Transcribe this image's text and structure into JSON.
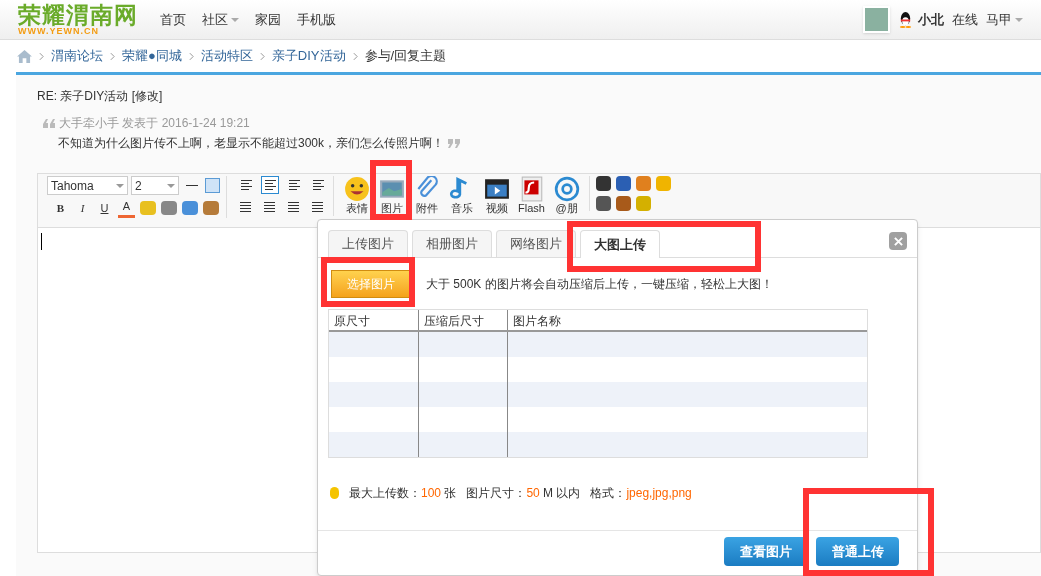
{
  "header": {
    "logo": "荣耀渭南网",
    "logo_sub": "WWW.YEWN.CN",
    "nav": [
      {
        "label": "首页",
        "dropdown": false
      },
      {
        "label": "社区",
        "dropdown": true
      },
      {
        "label": "家园",
        "dropdown": false
      },
      {
        "label": "手机版",
        "dropdown": false
      }
    ],
    "user": {
      "name": "小北",
      "status": "在线",
      "menu": "马甲"
    }
  },
  "breadcrumb": [
    {
      "label": "渭南论坛",
      "link": true
    },
    {
      "label": "荣耀●同城",
      "link": true
    },
    {
      "label": "活动特区",
      "link": true
    },
    {
      "label": "亲子DIY活动",
      "link": true
    },
    {
      "label": "参与/回复主题",
      "link": false
    }
  ],
  "post": {
    "title": "RE: 亲子DIY活动 [修改]",
    "quote_meta": "大手牵小手 发表于 2016-1-24 19:21",
    "quote_text": "不知道为什么图片传不上啊，老显示不能超过300k，亲们怎么传照片啊！"
  },
  "toolbar": {
    "font": "Tahoma",
    "size": "2",
    "format": [
      "B",
      "I",
      "U",
      "A"
    ],
    "align": [
      {
        "selected": false
      },
      {
        "selected": true
      },
      {
        "selected": false
      },
      {
        "selected": false
      }
    ],
    "big_buttons": [
      {
        "label": "表情",
        "kind": "smile"
      },
      {
        "label": "图片",
        "kind": "image"
      },
      {
        "label": "附件",
        "kind": "clip"
      },
      {
        "label": "音乐",
        "kind": "music"
      },
      {
        "label": "视频",
        "kind": "video"
      },
      {
        "label": "Flash",
        "kind": "flash"
      },
      {
        "label": "@朋",
        "kind": "at"
      }
    ]
  },
  "dialog": {
    "tabs": [
      {
        "label": "上传图片",
        "selected": false
      },
      {
        "label": "相册图片",
        "selected": false
      },
      {
        "label": "网络图片",
        "selected": false
      },
      {
        "label": "大图上传",
        "selected": true
      }
    ],
    "select_button": "选择图片",
    "hint": "大于 500K 的图片将会自动压缩后上传，一键压缩，轻松上大图！",
    "columns": [
      "原尺寸",
      "压缩后尺寸",
      "图片名称"
    ],
    "limits": [
      {
        "label": "最大上传数：",
        "value": "100",
        "unit": "张"
      },
      {
        "label": "图片尺寸：",
        "value": "50",
        "unit": "M 以内"
      },
      {
        "label": "格式：",
        "value": "jpeg,jpg,png"
      }
    ],
    "buttons": [
      "查看图片",
      "普通上传"
    ]
  }
}
